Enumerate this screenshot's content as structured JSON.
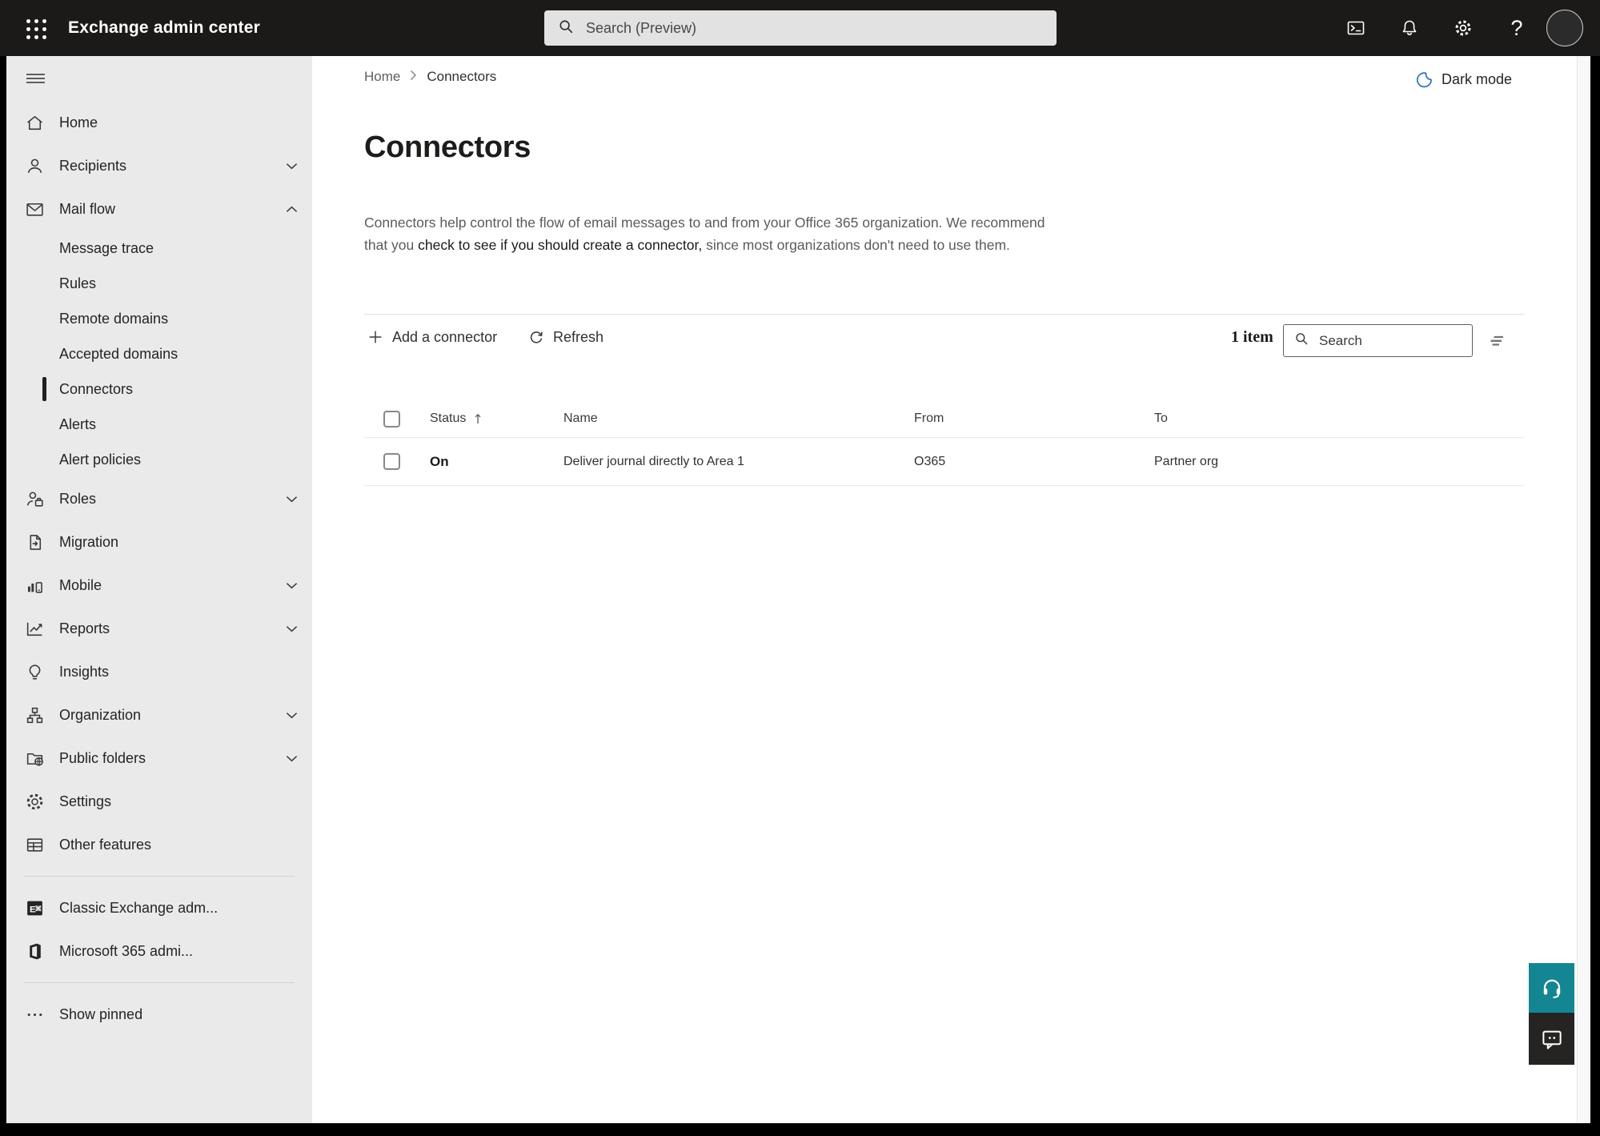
{
  "topbar": {
    "title": "Exchange admin center",
    "search_placeholder": "Search (Preview)",
    "icons": [
      "app-launcher-icon",
      "search-icon",
      "cloud-shell-icon",
      "notifications-icon",
      "settings-icon",
      "help-icon",
      "account-avatar"
    ]
  },
  "sidebar": {
    "items": [
      {
        "label": "Home",
        "icon": "home-icon"
      },
      {
        "label": "Recipients",
        "icon": "recipients-icon",
        "chevron": "down"
      },
      {
        "label": "Mail flow",
        "icon": "mail-flow-icon",
        "chevron": "up",
        "expanded": true
      },
      {
        "label": "Message trace",
        "sub": true
      },
      {
        "label": "Rules",
        "sub": true
      },
      {
        "label": "Remote domains",
        "sub": true
      },
      {
        "label": "Accepted domains",
        "sub": true
      },
      {
        "label": "Connectors",
        "sub": true,
        "selected": true
      },
      {
        "label": "Alerts",
        "sub": true
      },
      {
        "label": "Alert policies",
        "sub": true
      },
      {
        "label": "Roles",
        "icon": "roles-icon",
        "chevron": "down"
      },
      {
        "label": "Migration",
        "icon": "migration-icon"
      },
      {
        "label": "Mobile",
        "icon": "mobile-icon",
        "chevron": "down"
      },
      {
        "label": "Reports",
        "icon": "reports-icon",
        "chevron": "down"
      },
      {
        "label": "Insights",
        "icon": "insights-icon"
      },
      {
        "label": "Organization",
        "icon": "organization-icon",
        "chevron": "down"
      },
      {
        "label": "Public folders",
        "icon": "public-folders-icon",
        "chevron": "down"
      },
      {
        "label": "Settings",
        "icon": "settings-icon"
      },
      {
        "label": "Other features",
        "icon": "other-features-icon"
      }
    ],
    "footer_items": [
      {
        "label": "Classic Exchange adm...",
        "icon": "classic-exchange-icon"
      },
      {
        "label": "Microsoft 365 admi...",
        "icon": "microsoft-365-icon"
      }
    ],
    "show_pinned": "Show pinned"
  },
  "main": {
    "breadcrumb": {
      "home": "Home",
      "current": "Connectors"
    },
    "dark_mode_label": "Dark mode",
    "page_title": "Connectors",
    "description": {
      "pre": "Connectors help control the flow of email messages to and from your Office 365 organization. We recommend that you ",
      "link": "check to see if you should create a connector,",
      "post": " since most organizations don't need to use them."
    },
    "toolbar": {
      "add_label": "Add a connector",
      "refresh_label": "Refresh",
      "item_count": "1 item",
      "search_placeholder": "Search"
    },
    "table": {
      "columns": {
        "status": "Status",
        "name": "Name",
        "from": "From",
        "to": "To"
      },
      "sorted_by": "Status ascending",
      "rows": [
        {
          "status": "On",
          "name": "Deliver journal directly to Area 1",
          "from": "O365",
          "to": "Partner org"
        }
      ]
    }
  },
  "floating": {
    "support_icon": "headset-icon",
    "feedback_icon": "feedback-bubble-icon"
  },
  "colors": {
    "topbar_bg": "#1b1a19",
    "sidebar_bg": "#eaeaea",
    "accent_moon_blue": "#2f6fc1",
    "support_teal": "#148693",
    "feedback_dark": "#252423"
  }
}
